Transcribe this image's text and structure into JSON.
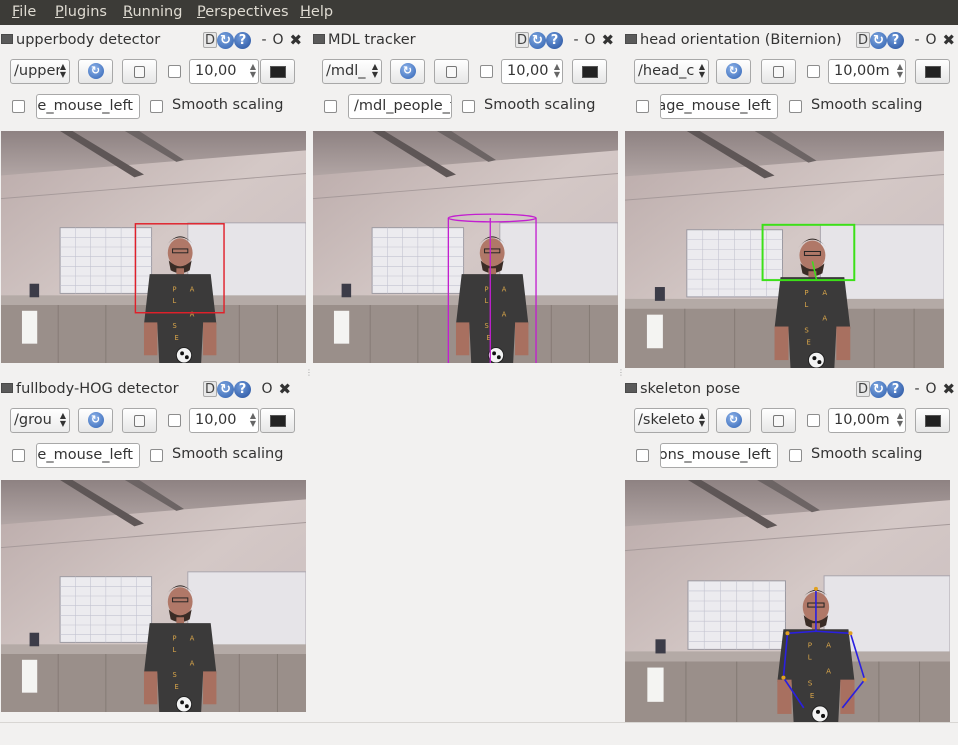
{
  "menu": [
    {
      "label": "File",
      "accel": "F",
      "rest": "ile"
    },
    {
      "label": "Plugins",
      "accel": "P",
      "rest": "lugins"
    },
    {
      "label": "Running",
      "accel": "R",
      "rest": "unning"
    },
    {
      "label": "Perspectives",
      "accel": "P",
      "rest": "erspectives"
    },
    {
      "label": "Help",
      "accel": "H",
      "rest": "elp"
    }
  ],
  "panels": [
    {
      "title": "upperbody detector",
      "topic": "/upperbody",
      "zoom": "10,00",
      "mouse_topic": "ge_mouse_left",
      "smooth_label": "Smooth scaling",
      "overlay": "red-box"
    },
    {
      "title": "MDL tracker",
      "topic": "/mdl_",
      "zoom": "10,00",
      "mouse_topic": "/mdl_people_tr",
      "smooth_label": "Smooth scaling",
      "overlay": "cylinder"
    },
    {
      "title": "head orientation (Biternion)",
      "topic": "/head_c",
      "zoom": "10,00m",
      "mouse_topic": "nage_mouse_left",
      "smooth_label": "Smooth scaling",
      "overlay": "green-box"
    },
    {
      "title": "fullbody-HOG detector",
      "topic": "/grou",
      "zoom": "10,00",
      "mouse_topic": "ge_mouse_left",
      "smooth_label": "Smooth scaling",
      "overlay": "none"
    },
    {
      "title": "skeleton pose",
      "topic": "/skeleto",
      "zoom": "10,00m",
      "mouse_topic": "tons_mouse_left",
      "smooth_label": "Smooth scaling",
      "overlay": "skeleton"
    }
  ],
  "icons": {
    "dock": "dock-icon",
    "detach": "D",
    "reload": "reload-icon",
    "help": "?",
    "minimize": "-",
    "restore": "O",
    "close": "✖"
  },
  "colors": {
    "menubar": "#3c3b37",
    "red_box": "#e0202a",
    "green_box": "#3ce018",
    "cylinder": "#c21fd0",
    "skeleton": "#2a1fe0"
  }
}
